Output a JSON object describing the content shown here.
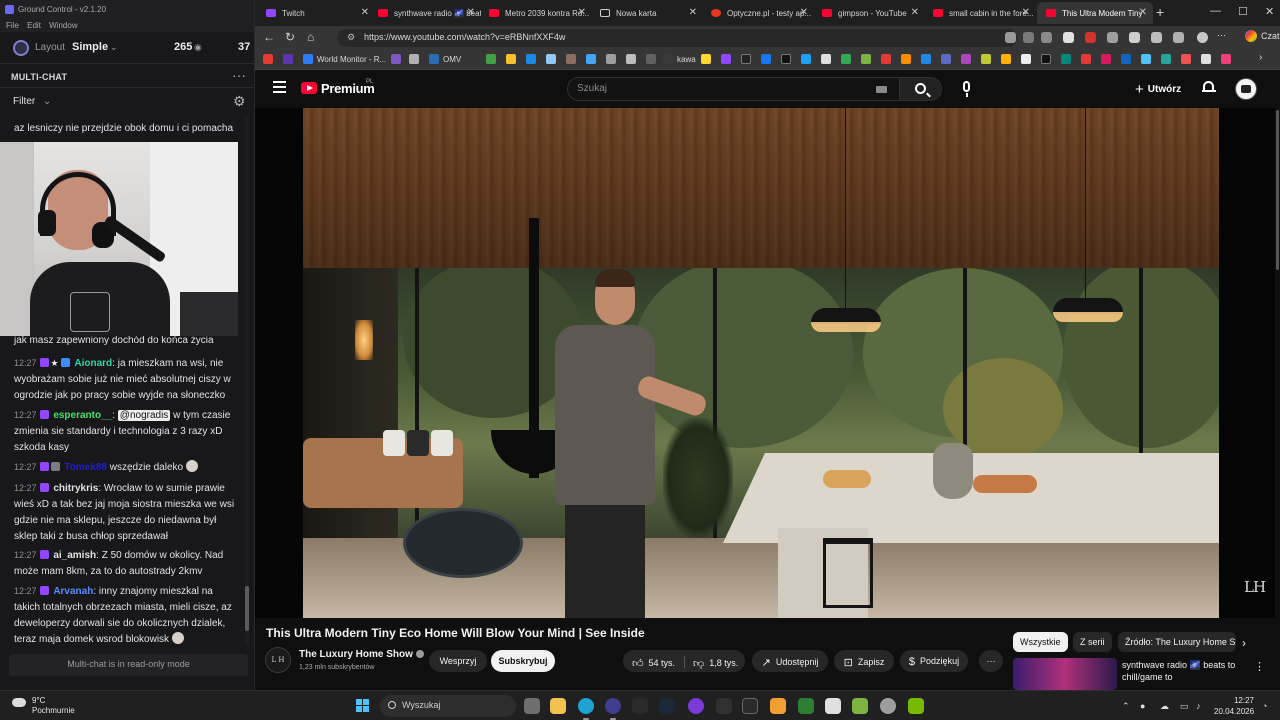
{
  "ground_control": {
    "title": "Ground Control - v2.1.20",
    "menu": [
      "File",
      "Edit",
      "Window"
    ],
    "layout_label": "Layout",
    "layout_value": "Simple",
    "viewer_count": "265",
    "count_second": "37",
    "multichat_title": "MULTI-CHAT",
    "filter_label": "Filter",
    "readonly_notice": "Multi-chat is in read-only mode",
    "messages": [
      {
        "text": "az lesniczy nie przejdzie obok domu i ci pomacha"
      },
      {
        "text": "jak masz zapewniony dochód do końca życia"
      },
      {
        "time": "12:27",
        "user": "Aionard",
        "user_color": "#2fd7a8",
        "text": "ja mieszkam na wsi, nie wyobrażam sobie już nie mieć absolutnej ciszy w ogrodzie jak po pracy sobie wyjde na słoneczko"
      },
      {
        "time": "12:27",
        "user": "esperanto__",
        "user_color": "#44e06c",
        "mention": "@nogradis",
        "text": "w tym czasie zmienia sie standardy i technologia z 3 razy xD szkoda kasy"
      },
      {
        "time": "12:27",
        "user": "Tomek88",
        "user_color": "#1f1fd6",
        "text": "wszędzie daleko"
      },
      {
        "time": "12:27",
        "user": "chitrykris",
        "user_color": "#e8e8e8",
        "text": "Wrocław to w sumie prawie wieś xD a tak bez jaj moja siostra mieszka we wsi gdzie nie ma sklepu, jeszcze do niedawna był sklep taki z busa chłop sprzedawał"
      },
      {
        "time": "12:27",
        "user": "ai_amish",
        "user_color": "#e8e8e8",
        "text": "Z 50 domów w okolicy. Nad może mam 8km, za to do autostrady 2kmv"
      },
      {
        "time": "12:27",
        "user": "Arvanah",
        "user_color": "#5a8cff",
        "text": "inny znajomy mieszkal na takich totalnych obrzezach miasta, mieli cisze, az deweloperzy dorwali sie do okolicznych dzialek, teraz maja domek wsrod blokowisk"
      }
    ]
  },
  "browser": {
    "tabs": [
      {
        "label": "Twitch",
        "icon": "twitch-icon"
      },
      {
        "label": "synthwave radio 🌌 beats to",
        "icon": "youtube-icon"
      },
      {
        "label": "Metro 2039 kontra Ro...",
        "icon": "youtube-icon"
      },
      {
        "label": "Nowa karta",
        "icon": "newtab-icon"
      },
      {
        "label": "Optyczne.pl - testy ap...",
        "icon": "optyczne-icon"
      },
      {
        "label": "gimpson - YouTube",
        "icon": "youtube-icon"
      },
      {
        "label": "small cabin in the fore...",
        "icon": "youtube-icon"
      },
      {
        "label": "This Ultra Modern Tiny",
        "icon": "youtube-icon",
        "active": true
      }
    ],
    "url": "https://www.youtube.com/watch?v=eRBNnfXXF4w",
    "chat_label": "Czat",
    "bookmarks": [
      {
        "label": "World Monitor - R...",
        "color": "#2f7df6"
      },
      {
        "label": "OMV",
        "color": "#2a6db5"
      },
      {
        "label": "kawa",
        "color": "#3a3a3a"
      }
    ]
  },
  "youtube": {
    "brand": "Premium",
    "region": "PL",
    "search_placeholder": "Szukaj",
    "create_label": "Utwórz",
    "video_title": "This Ultra Modern Tiny Eco Home Will Blow Your Mind | See Inside",
    "channel_initials": "L H",
    "channel_name": "The Luxury Home Show",
    "subscribers": "1,23 mln subskrybentów",
    "support_label": "Wesprzyj",
    "subscribe_label": "Subskrybuj",
    "likes": "54 tys.",
    "dislikes": "1,8 tys.",
    "share_label": "Udostępnij",
    "save_label": "Zapisz",
    "thanks_label": "Podziękuj",
    "watermark": "LH",
    "chips": [
      "Wszystkie",
      "Z serii",
      "Źródło: The Luxury Home Show"
    ],
    "recommendation_title": "synthwave radio 🌌 beats to chill/game to"
  },
  "taskbar": {
    "temperature": "9°C",
    "weather": "Pochmurnie",
    "search_placeholder": "Wyszukaj",
    "time": "12:27",
    "date": "20.04.2026"
  }
}
